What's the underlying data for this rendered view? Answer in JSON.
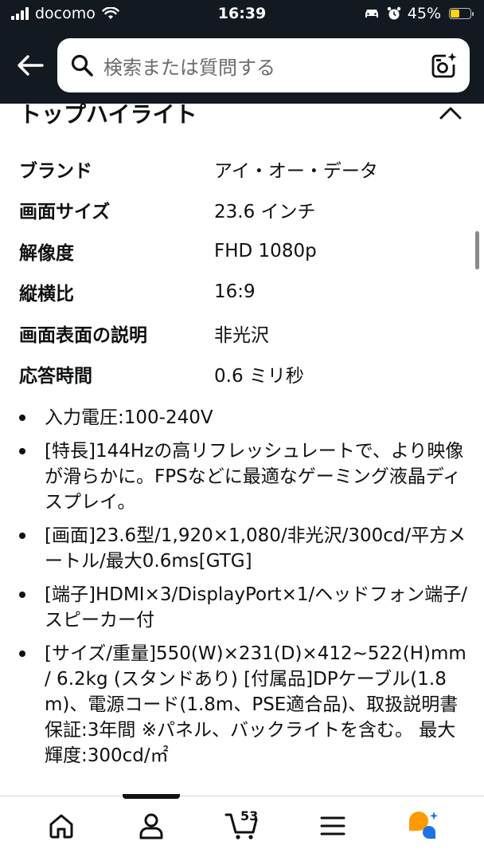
{
  "status_bar": {
    "carrier": "docomo",
    "time": "16:39",
    "battery": "45%",
    "battery_level": 0.45
  },
  "header": {
    "search_placeholder": "検索または質問する",
    "icons": [
      "back-arrow-icon",
      "search-icon",
      "camera-search-icon"
    ]
  },
  "section": {
    "title": "トップハイライト"
  },
  "specs": [
    {
      "label": "ブランド",
      "value": "アイ・オー・データ"
    },
    {
      "label": "画面サイズ",
      "value": "23.6 インチ"
    },
    {
      "label": "解像度",
      "value": "FHD 1080p"
    },
    {
      "label": "縦横比",
      "value": "16:9"
    },
    {
      "label": "画面表面の説明",
      "value": "非光沢"
    },
    {
      "label": "応答時間",
      "value": "0.6 ミリ秒"
    }
  ],
  "bullets": [
    "入力電圧:100-240V",
    "[特長]144Hzの高リフレッシュレートで、より映像が滑らかに。FPSなどに最適なゲーミング液晶ディスプレイ。",
    "[画面]23.6型/1,920×1,080/非光沢/300cd/平方メートル/最大0.6ms[GTG]",
    "[端子]HDMI×3/DisplayPort×1/ヘッドフォン端子/スピーカー付",
    "[サイズ/重量]550(W)×231(D)×412~522(H)mm / 6.2kg (スタンドあり) [付属品]DPケーブル(1.8m)、電源コード(1.8m、PSE適合品)、取扱説明書 保証:3年間 ※パネル、バックライトを含む。 最大輝度:300cd/㎡"
  ],
  "bottom_nav": {
    "cart_count": "53",
    "items": [
      "home-icon",
      "account-icon",
      "cart-icon",
      "menu-icon",
      "rufus-assistant-icon"
    ],
    "active_index": 1
  },
  "colors": {
    "header_bg": "#131921",
    "battery_fill": "#f7d415",
    "assistant_orange": "#ff9900",
    "assistant_blue": "#1a73e8"
  }
}
